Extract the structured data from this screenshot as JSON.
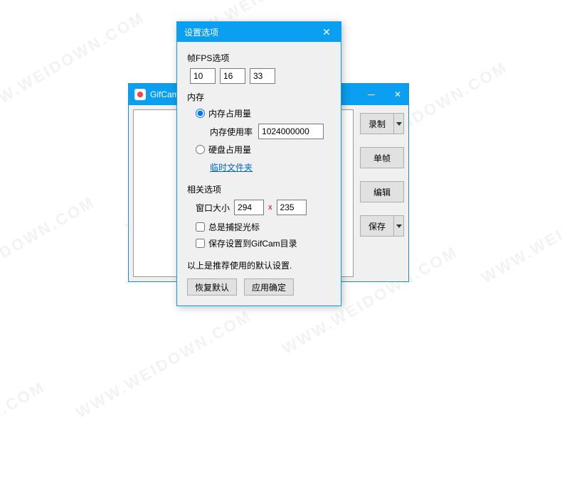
{
  "watermark": "WWW.WEIDOWN.COM",
  "gifcam": {
    "title": "GifCam",
    "buttons": {
      "record": "录制",
      "frame": "单帧",
      "edit": "编辑",
      "save": "保存"
    }
  },
  "settings": {
    "title": "设置选项",
    "fps": {
      "label": "帧FPS选项",
      "values": [
        "10",
        "16",
        "33"
      ]
    },
    "memory": {
      "label": "内存",
      "opt_mem": "内存占用量",
      "usage_label": "内存使用率",
      "usage_value": "1024000000",
      "opt_disk": "硬盘占用量",
      "temp_link": "临时文件夹"
    },
    "related": {
      "label": "相关选项",
      "size_label": "窗口大小",
      "width": "294",
      "x": "x",
      "height": "235",
      "capture_cursor": "总是捕捉光标",
      "save_to_dir": "保存设置到GifCam目录"
    },
    "footer_note": "以上是推荐使用的默认设置.",
    "btn_restore": "恢复默认",
    "btn_apply": "应用确定"
  }
}
